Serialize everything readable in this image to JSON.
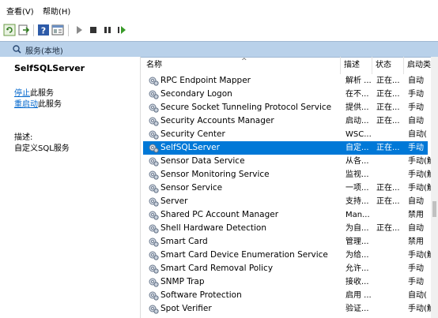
{
  "menu": {
    "view": "查看(V)",
    "help": "帮助(H)"
  },
  "toolbar": {
    "buttons": [
      "refresh-icon",
      "export-icon",
      "help-icon",
      "properties-icon",
      "start-icon",
      "stop-icon",
      "pause-icon",
      "restart-icon"
    ]
  },
  "panel": {
    "title": "服务(本地)"
  },
  "left": {
    "service_name": "SelfSQLServer",
    "stop_link": "停止",
    "stop_suffix": "此服务",
    "restart_link": "重启动",
    "restart_suffix": "此服务",
    "desc_label": "描述:",
    "desc_text": "自定义SQL服务"
  },
  "columns": {
    "name": "名称",
    "desc": "描述",
    "status": "状态",
    "startup": "启动类"
  },
  "rows": [
    {
      "name": "RPC Endpoint Mapper",
      "desc": "解析 ...",
      "status": "正在...",
      "startup": "自动"
    },
    {
      "name": "Secondary Logon",
      "desc": "在不...",
      "status": "正在...",
      "startup": "手动"
    },
    {
      "name": "Secure Socket Tunneling Protocol Service",
      "desc": "提供...",
      "status": "正在...",
      "startup": "手动"
    },
    {
      "name": "Security Accounts Manager",
      "desc": "启动...",
      "status": "正在...",
      "startup": "自动"
    },
    {
      "name": "Security Center",
      "desc": "WSC...",
      "status": "",
      "startup": "自动("
    },
    {
      "name": "SelfSQLServer",
      "desc": "自定...",
      "status": "正在...",
      "startup": "手动",
      "selected": true
    },
    {
      "name": "Sensor Data Service",
      "desc": "从各...",
      "status": "",
      "startup": "手动(触"
    },
    {
      "name": "Sensor Monitoring Service",
      "desc": "监视...",
      "status": "",
      "startup": "手动(触"
    },
    {
      "name": "Sensor Service",
      "desc": "一项...",
      "status": "正在...",
      "startup": "手动(触"
    },
    {
      "name": "Server",
      "desc": "支持...",
      "status": "正在...",
      "startup": "自动"
    },
    {
      "name": "Shared PC Account Manager",
      "desc": "Man...",
      "status": "",
      "startup": "禁用"
    },
    {
      "name": "Shell Hardware Detection",
      "desc": "为自...",
      "status": "正在...",
      "startup": "自动"
    },
    {
      "name": "Smart Card",
      "desc": "管理...",
      "status": "",
      "startup": "禁用"
    },
    {
      "name": "Smart Card Device Enumeration Service",
      "desc": "为给...",
      "status": "",
      "startup": "手动(触"
    },
    {
      "name": "Smart Card Removal Policy",
      "desc": "允许...",
      "status": "",
      "startup": "手动"
    },
    {
      "name": "SNMP Trap",
      "desc": "接收...",
      "status": "",
      "startup": "手动"
    },
    {
      "name": "Software Protection",
      "desc": "启用 ...",
      "status": "",
      "startup": "自动("
    },
    {
      "name": "Spot Verifier",
      "desc": "验证...",
      "status": "",
      "startup": "手动(触"
    }
  ],
  "colors": {
    "selection": "#0078d7",
    "header": "#b9d1ea",
    "link": "#0066cc"
  }
}
